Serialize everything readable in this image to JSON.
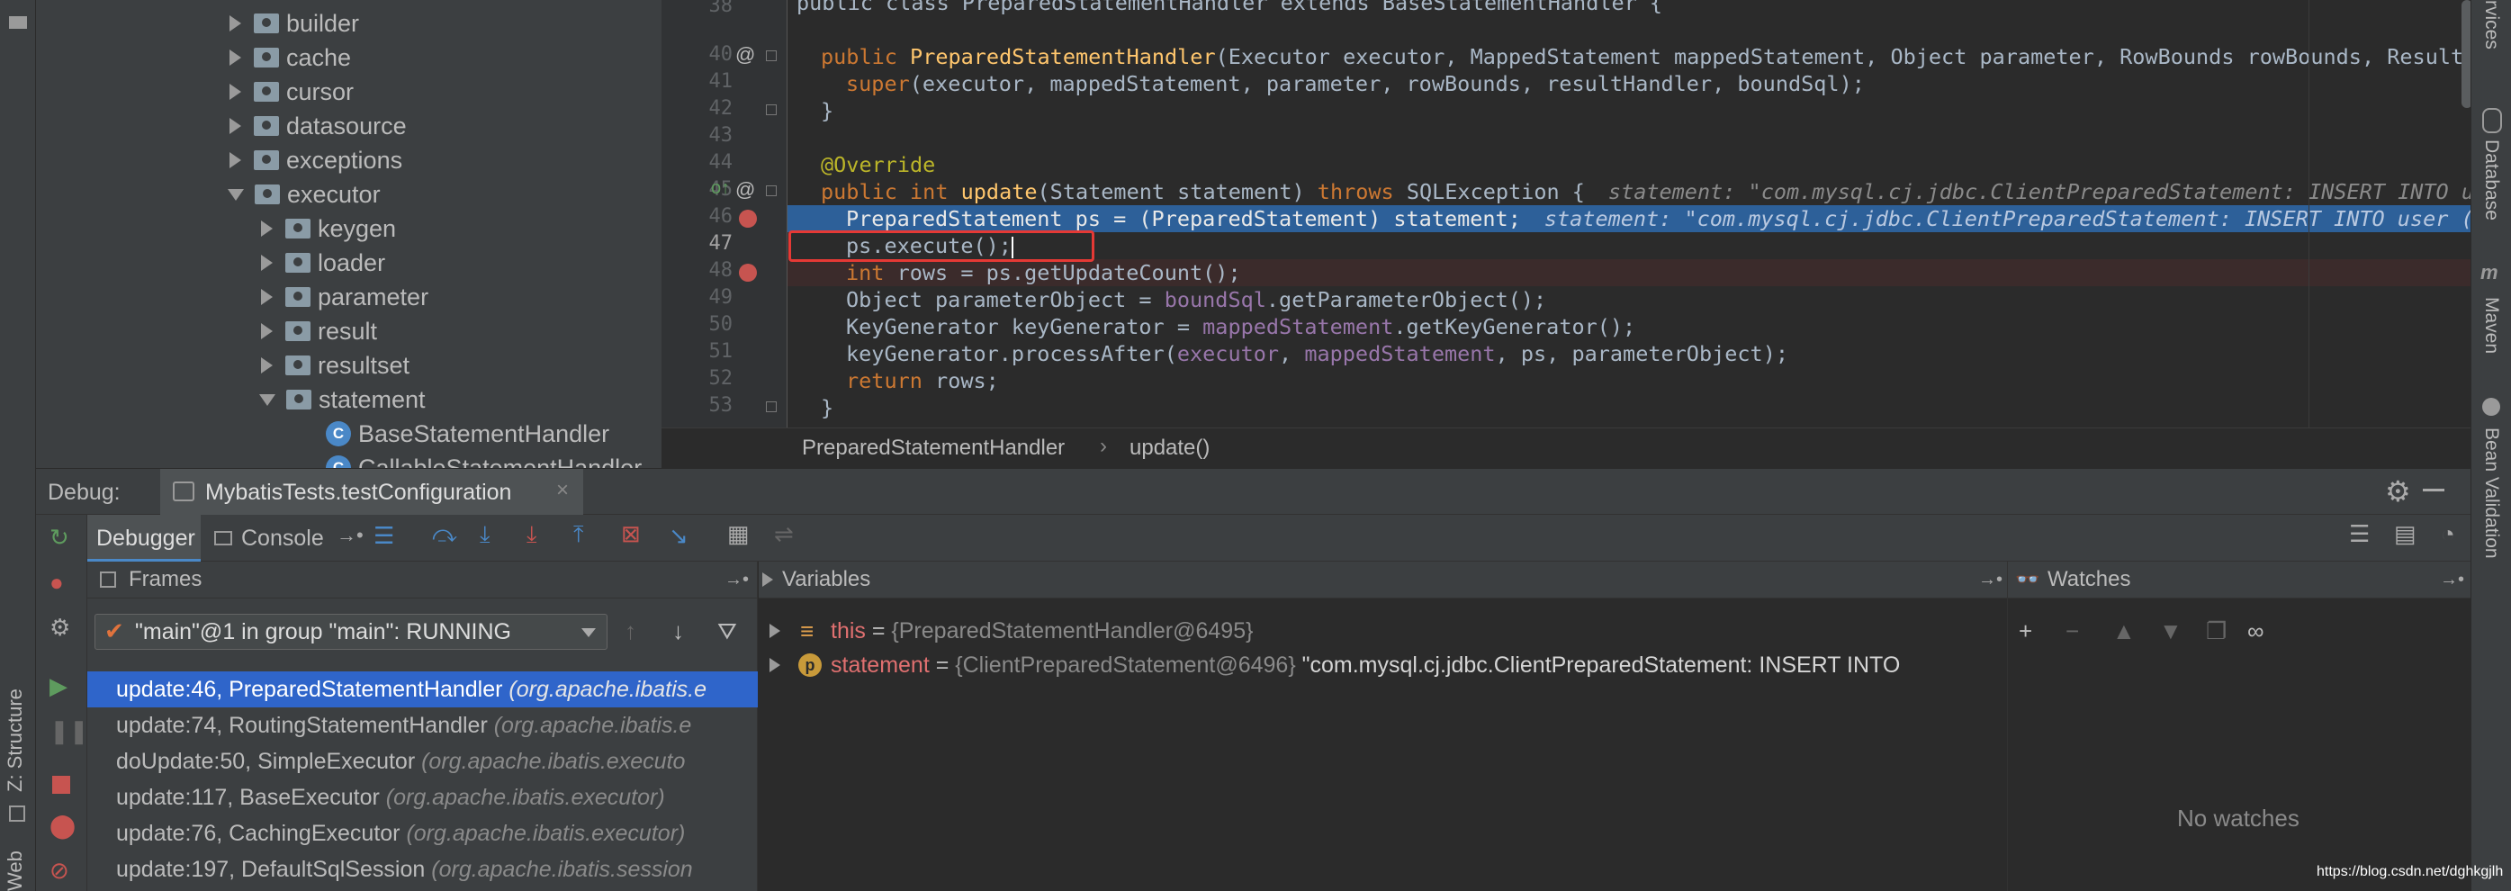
{
  "left_strip": {
    "structure_label": "Z: Structure",
    "web_label": "Web"
  },
  "right_strip": {
    "services_label": "rvices",
    "database_label": "Database",
    "maven_label": "Maven",
    "bean_label": "Bean Validation"
  },
  "project_tree": {
    "items": [
      {
        "label": "builder",
        "expanded": false
      },
      {
        "label": "cache",
        "expanded": false
      },
      {
        "label": "cursor",
        "expanded": false
      },
      {
        "label": "datasource",
        "expanded": false
      },
      {
        "label": "exceptions",
        "expanded": false
      },
      {
        "label": "executor",
        "expanded": true
      },
      {
        "label": "keygen",
        "expanded": false
      },
      {
        "label": "loader",
        "expanded": false
      },
      {
        "label": "parameter",
        "expanded": false
      },
      {
        "label": "result",
        "expanded": false
      },
      {
        "label": "resultset",
        "expanded": false
      },
      {
        "label": "statement",
        "expanded": true
      },
      {
        "label": "BaseStatementHandler",
        "expanded": false
      },
      {
        "label": "CallableStatementHandler",
        "expanded": false
      }
    ]
  },
  "editor": {
    "line_numbers": [
      "38",
      "40",
      "41",
      "42",
      "43",
      "44",
      "45",
      "46",
      "47",
      "48",
      "49",
      "50",
      "51",
      "52",
      "53"
    ],
    "lines": {
      "l38": "public class PreparedStatementHandler extends BaseStatementHandler {",
      "l40_kw": "public ",
      "l40_fn": "PreparedStatementHandler",
      "l40_rest": "(Executor executor, MappedStatement mappedStatement, Object parameter, RowBounds rowBounds, ResultHa",
      "l41_kw": "super",
      "l41_rest": "(executor, mappedStatement, parameter, rowBounds, resultHandler, boundSql);",
      "l42": "}",
      "l44": "@Override",
      "l45_kw1": "public int ",
      "l45_fn": "update",
      "l45_mid": "(Statement statement) ",
      "l45_kw2": "throws ",
      "l45_rest": "SQLException {",
      "l45_hint": "statement: \"com.mysql.cj.jdbc.ClientPreparedStatement: INSERT INTO user (id",
      "l46_code": "PreparedStatement ps = (PreparedStatement) statement;",
      "l46_hint": "statement: \"com.mysql.cj.jdbc.ClientPreparedStatement: INSERT INTO user (id",
      "l47": "ps.execute();",
      "l48_kw": "int ",
      "l48_rest": "rows = ps.getUpdateCount();",
      "l49_a": "Object parameterObject = ",
      "l49_fld": "boundSql",
      "l49_b": ".getParameterObject();",
      "l50_a": "KeyGenerator keyGenerator = ",
      "l50_fld": "mappedStatement",
      "l50_b": ".getKeyGenerator();",
      "l51_a": "keyGenerator.processAfter(",
      "l51_fld1": "executor",
      "l51_c1": ", ",
      "l51_fld2": "mappedStatement",
      "l51_b": ", ps, parameterObject);",
      "l52_kw": "return ",
      "l52_rest": "rows;",
      "l53": "}"
    },
    "breadcrumb": {
      "class": "PreparedStatementHandler",
      "sep": "›",
      "method": "update()"
    }
  },
  "debug": {
    "label": "Debug:",
    "session_tab": "MybatisTests.testConfiguration",
    "tab_debugger": "Debugger",
    "tab_console": "Console",
    "frames_title": "Frames",
    "thread_select": "\"main\"@1 in group \"main\": RUNNING",
    "frames": [
      {
        "loc": "update:46, PreparedStatementHandler",
        "pkg": "(org.apache.ibatis.e"
      },
      {
        "loc": "update:74, RoutingStatementHandler",
        "pkg": "(org.apache.ibatis.e"
      },
      {
        "loc": "doUpdate:50, SimpleExecutor",
        "pkg": "(org.apache.ibatis.executo"
      },
      {
        "loc": "update:117, BaseExecutor",
        "pkg": "(org.apache.ibatis.executor)"
      },
      {
        "loc": "update:76, CachingExecutor",
        "pkg": "(org.apache.ibatis.executor)"
      },
      {
        "loc": "update:197, DefaultSqlSession",
        "pkg": "(org.apache.ibatis.session"
      }
    ],
    "variables_title": "Variables",
    "variables": [
      {
        "icon": "≡",
        "name": "this",
        "eq": " = ",
        "value": "{PreparedStatementHandler@6495}",
        "extra": ""
      },
      {
        "icon": "p",
        "name": "statement",
        "eq": " = ",
        "value": "{ClientPreparedStatement@6496}",
        "extra": " \"com.mysql.cj.jdbc.ClientPreparedStatement: INSERT INTO"
      }
    ],
    "watches_title": "Watches",
    "no_watches": "No watches"
  },
  "watermark": "https://blog.csdn.net/dghkgjlh",
  "colors": {
    "accent": "#2f65ca",
    "highlight": "#2d6099",
    "redbox": "#e53935"
  }
}
